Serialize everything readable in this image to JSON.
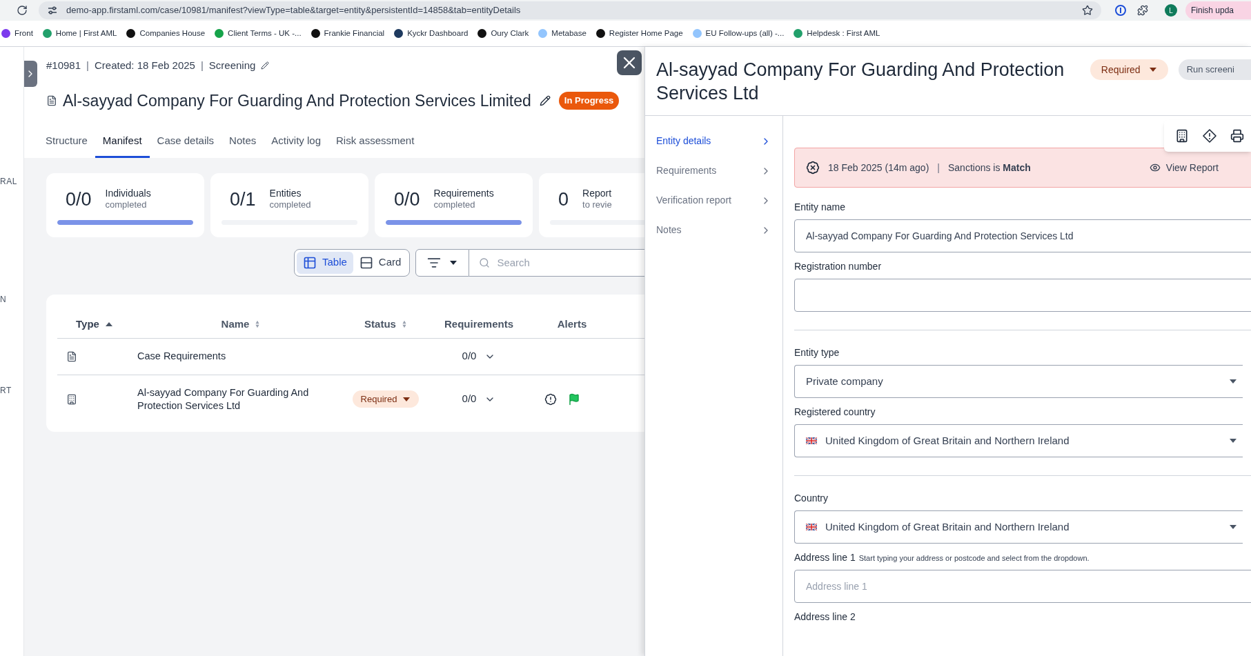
{
  "browser": {
    "url": "demo-app.firstaml.com/case/10981/manifest?viewType=table&target=entity&persistentId=14858&tab=entityDetails",
    "profile_initial": "L",
    "update_button": "Finish upda",
    "bookmarks": [
      {
        "label": "Front",
        "color": "#7c3aed"
      },
      {
        "label": "Home | First AML",
        "color": "#22a06b"
      },
      {
        "label": "Companies House",
        "color": "#111111"
      },
      {
        "label": "Client Terms - UK -...",
        "color": "#16a34a"
      },
      {
        "label": "Frankie Financial",
        "color": "#111111"
      },
      {
        "label": "Kyckr Dashboard",
        "color": "#1e3a5f"
      },
      {
        "label": "Oury Clark",
        "color": "#111111"
      },
      {
        "label": "Metabase",
        "color": "#93c5fd"
      },
      {
        "label": "Register Home Page",
        "color": "#111111"
      },
      {
        "label": "EU Follow-ups (all) -...",
        "color": "#93c5fd"
      },
      {
        "label": "Helpdesk : First AML",
        "color": "#22a06b"
      }
    ]
  },
  "background_sidebar": {
    "labels": [
      "RAL",
      "N",
      "RT"
    ]
  },
  "case": {
    "meta": [
      "#10981",
      "|",
      "Created: 18 Feb 2025",
      "|",
      "Screening"
    ],
    "title": "Al-sayyad Company For Guarding And Protection Services Limited",
    "status": "In Progress"
  },
  "tabs": [
    {
      "label": "Structure",
      "selected": false
    },
    {
      "label": "Manifest",
      "selected": true
    },
    {
      "label": "Case details",
      "selected": false
    },
    {
      "label": "Notes",
      "selected": false
    },
    {
      "label": "Activity log",
      "selected": false
    },
    {
      "label": "Risk assessment",
      "selected": false
    }
  ],
  "stats": [
    {
      "value": "0/0",
      "label": "Individuals",
      "sublabel": "completed",
      "level": 1
    },
    {
      "value": "0/1",
      "label": "Entities",
      "sublabel": "completed",
      "level": 0
    },
    {
      "value": "0/0",
      "label": "Requirements",
      "sublabel": "completed",
      "level": 1
    },
    {
      "value": "0",
      "label": "Report",
      "sublabel": "to revie",
      "level": 0
    }
  ],
  "view_toggle": [
    {
      "label": "Table",
      "selected": true
    },
    {
      "label": "Card",
      "selected": false
    }
  ],
  "search": {
    "placeholder": "Search"
  },
  "table": {
    "columns": [
      {
        "label": "Type",
        "sortable": true,
        "sorted": true
      },
      {
        "label": "Name",
        "sortable": true,
        "sorted": false
      },
      {
        "label": "Status",
        "sortable": true,
        "sorted": false
      },
      {
        "label": "Requirements",
        "sortable": false,
        "sorted": false
      },
      {
        "label": "Alerts",
        "sortable": false,
        "sorted": false
      }
    ],
    "rows": [
      {
        "kind": "case",
        "name": "Case Requirements",
        "requirements": "0/0",
        "alerts": false
      },
      {
        "kind": "entity",
        "name": "Al-sayyad Company For Guarding And Protection Services Ltd",
        "status": "Required",
        "requirements": "0/0",
        "alerts": true
      }
    ]
  },
  "entity_panel": {
    "title": "Al-sayyad Company For Guarding And Protection Services Ltd",
    "status": "Required",
    "run_button": "Run screeni",
    "nav": [
      {
        "label": "Entity details",
        "selected": true
      },
      {
        "label": "Requirements",
        "selected": false
      },
      {
        "label": "Verification report",
        "selected": false
      },
      {
        "label": "Notes",
        "selected": false
      }
    ],
    "alert": {
      "date": "18 Feb 2025 (14m ago)",
      "separator": "|",
      "message": "Sanctions is **Match**",
      "link": "View Report"
    },
    "fields": [
      {
        "kind": "text",
        "label": "Entity name",
        "value": "Al-sayyad Company For Guarding And Protection Services Ltd"
      },
      {
        "kind": "text",
        "label": "Registration number"
      },
      {
        "kind": "divider"
      },
      {
        "kind": "select",
        "label": "Entity type",
        "value": "Private company"
      },
      {
        "kind": "country",
        "label": "Registered country",
        "value": "United Kingdom of Great Britain and Northern Ireland"
      },
      {
        "kind": "divider"
      },
      {
        "kind": "country",
        "label": "Country",
        "value": "United Kingdom of Great Britain and Northern Ireland"
      },
      {
        "kind": "text",
        "label": "Address line 1",
        "hint": "Start typing your address or postcode and select from the dropdown.",
        "placeholder": "Address line 1"
      },
      {
        "kind": "label",
        "label": "Address line 2"
      }
    ]
  }
}
